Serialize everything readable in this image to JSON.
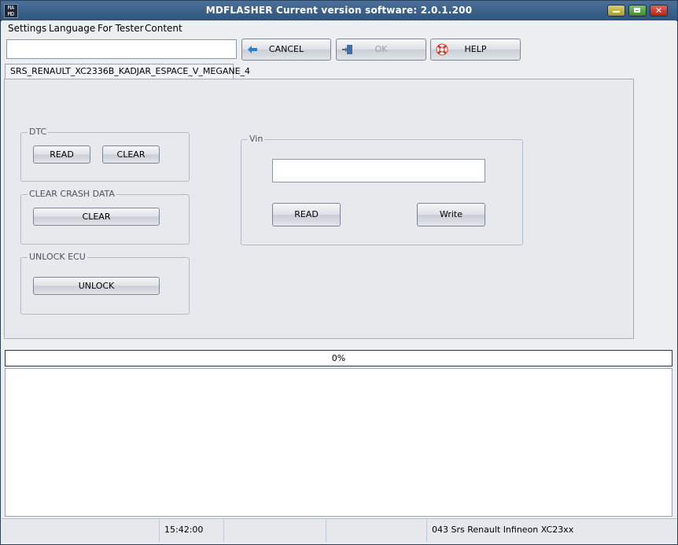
{
  "window": {
    "app_icon_text": "MA\nMD",
    "title": "MDFLASHER  Current version software: 2.0.1.200"
  },
  "menu": {
    "items": [
      {
        "label": "Settings"
      },
      {
        "label": "Language"
      },
      {
        "label": "For Tester"
      },
      {
        "label": "Content"
      }
    ]
  },
  "toolbar": {
    "input_value": "",
    "cancel_label": "CANCEL",
    "ok_label": "OK",
    "help_label": "HELP"
  },
  "tab": {
    "label": "SRS_RENAULT_XC2336B_KADJAR_ESPACE_V_MEGANE_4"
  },
  "dtc": {
    "title": "DTC",
    "read_label": "READ",
    "clear_label": "CLEAR"
  },
  "crash": {
    "title": "CLEAR CRASH DATA",
    "clear_label": "CLEAR"
  },
  "unlock": {
    "title": "UNLOCK ECU",
    "unlock_label": "UNLOCK"
  },
  "vin": {
    "title": "Vin",
    "value": "",
    "read_label": "READ",
    "write_label": "Write"
  },
  "progress": {
    "text": "0%",
    "value": 0
  },
  "status": {
    "time": "15:42:00",
    "module": "043 Srs Renault Infineon XC23xx"
  },
  "colors": {
    "titlebar": "#2f5680",
    "close": "#c8352a",
    "minimize": "#c9c04e",
    "maximize": "#5ea64a"
  }
}
